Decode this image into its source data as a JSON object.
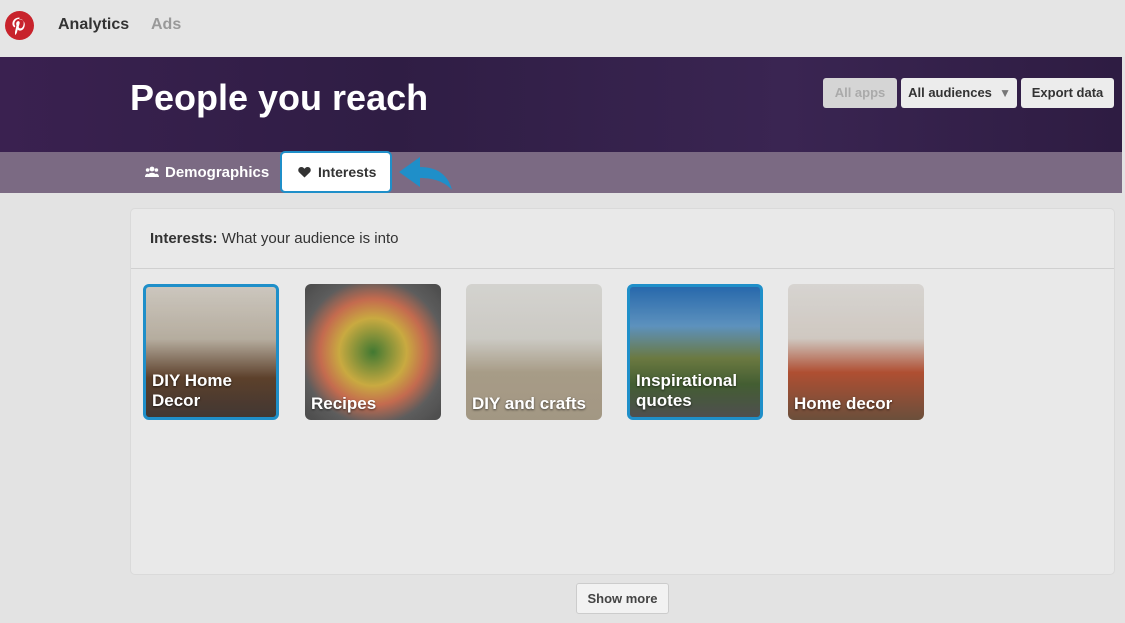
{
  "nav": {
    "analytics_label": "Analytics",
    "ads_label": "Ads"
  },
  "header": {
    "title": "People you reach",
    "all_apps_label": "All apps",
    "all_audiences_label": "All audiences",
    "export_label": "Export data"
  },
  "tabs": {
    "demographics_label": "Demographics",
    "interests_label": "Interests"
  },
  "panel": {
    "heading_bold": "Interests:",
    "heading_text": "What your audience is into"
  },
  "interests": [
    {
      "label": "DIY Home Decor",
      "selected": true
    },
    {
      "label": "Recipes",
      "selected": false
    },
    {
      "label": "DIY and crafts",
      "selected": false
    },
    {
      "label": "Inspirational quotes",
      "selected": true
    },
    {
      "label": "Home decor",
      "selected": false
    }
  ],
  "show_more_label": "Show more",
  "colors": {
    "brand": "#c8232c",
    "header_bg": "#352046",
    "tab_bar_bg": "#7b6a83",
    "highlight": "#1f8fc9"
  }
}
